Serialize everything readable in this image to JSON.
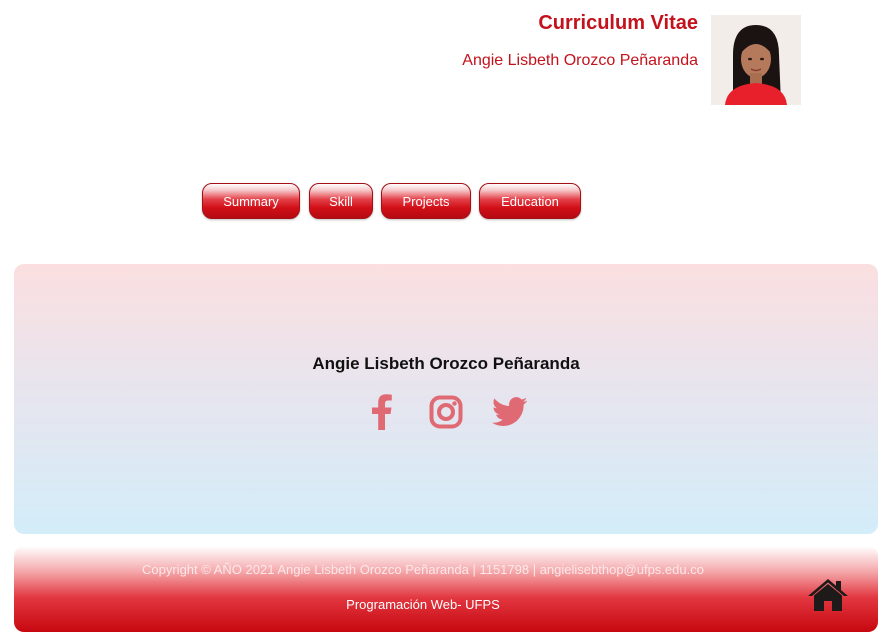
{
  "header": {
    "title": "Curriculum Vitae",
    "name": "Angie Lisbeth Orozco Peñaranda"
  },
  "nav": {
    "items": [
      {
        "label": "Summary"
      },
      {
        "label": "Skill"
      },
      {
        "label": "Projects"
      },
      {
        "label": "Education"
      }
    ]
  },
  "profile": {
    "name": "Angie Lisbeth Orozco Peñaranda",
    "social": [
      {
        "icon": "facebook-icon"
      },
      {
        "icon": "instagram-icon"
      },
      {
        "icon": "twitter-icon"
      }
    ]
  },
  "footer": {
    "copyright": "Copyright © AÑO 2021 Angie Lisbeth Orozco Peñaranda | 1151798 | angielisebthop@ufps.edu.co",
    "subtitle": "Programación Web- UFPS",
    "home_icon": "home-icon"
  },
  "colors": {
    "accent": "#c4121c",
    "social_icon": "#e06a73",
    "home_icon": "#1f1a1a"
  }
}
